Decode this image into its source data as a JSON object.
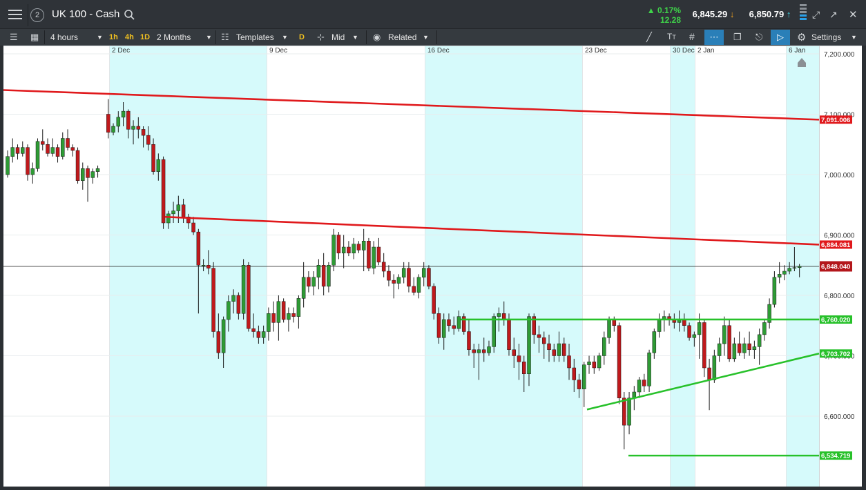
{
  "app": {
    "menu_icon": "hamburger-menu-icon",
    "layout_number": "2",
    "title": "UK 100 - Cash",
    "search_icon": "search-icon"
  },
  "quote": {
    "change_pct": "0.17%",
    "change_pts": "12.28",
    "sell": "6,845.29",
    "buy": "6,850.79",
    "up_color": "#3fd44a",
    "sell_bg": "#6b5530",
    "buy_bg": "#1f5e73"
  },
  "toolbar": {
    "interval": "4 hours",
    "quick_1h": "1h",
    "quick_4h": "4h",
    "quick_1d": "1D",
    "range": "2 Months",
    "templates": "Templates",
    "daily": "D",
    "price_type": "Mid",
    "related": "Related",
    "settings": "Settings"
  },
  "chart_data": {
    "type": "candlestick",
    "instrument": "UK 100 - Cash",
    "interval": "4 hours",
    "x_tick_labels": [
      "2 Dec",
      "9 Dec",
      "16 Dec",
      "23 Dec",
      "30 Dec",
      "2 Jan",
      "6 Jan"
    ],
    "y_tick_labels": [
      "7,200.000",
      "7,100.000",
      "7,000.000",
      "6,900.000",
      "6,800.000",
      "6,700.000",
      "6,600.000"
    ],
    "ylim": [
      6510,
      7215
    ],
    "grid": true,
    "current_price": "6,848.040",
    "candles_ohlc": [
      [
        7000,
        7040,
        6995,
        7030
      ],
      [
        7030,
        7060,
        7020,
        7045
      ],
      [
        7045,
        7050,
        7025,
        7035
      ],
      [
        7035,
        7055,
        7030,
        7045
      ],
      [
        7045,
        7050,
        6990,
        7000
      ],
      [
        7000,
        7020,
        6985,
        7010
      ],
      [
        7010,
        7060,
        7005,
        7055
      ],
      [
        7055,
        7075,
        7040,
        7050
      ],
      [
        7050,
        7060,
        7030,
        7035
      ],
      [
        7035,
        7060,
        7030,
        7045
      ],
      [
        7045,
        7050,
        7020,
        7030
      ],
      [
        7030,
        7070,
        7025,
        7060
      ],
      [
        7060,
        7075,
        7040,
        7045
      ],
      [
        7045,
        7050,
        7030,
        7040
      ],
      [
        7040,
        7045,
        6985,
        6990
      ],
      [
        6990,
        7020,
        6975,
        7010
      ],
      [
        7010,
        7015,
        6955,
        6995
      ],
      [
        6995,
        7010,
        6985,
        7005
      ],
      [
        7005,
        7015,
        6995,
        7010
      ],
      [
        7100,
        7125,
        7060,
        7070
      ],
      [
        7070,
        7085,
        7065,
        7080
      ],
      [
        7080,
        7105,
        7070,
        7095
      ],
      [
        7095,
        7120,
        7080,
        7105
      ],
      [
        7105,
        7108,
        7060,
        7075
      ],
      [
        7075,
        7090,
        7050,
        7080
      ],
      [
        7080,
        7095,
        7060,
        7075
      ],
      [
        7075,
        7080,
        7045,
        7065
      ],
      [
        7065,
        7080,
        7040,
        7050
      ],
      [
        7050,
        7060,
        7000,
        7005
      ],
      [
        7005,
        7035,
        6990,
        7025
      ],
      [
        7025,
        7030,
        6910,
        6920
      ],
      [
        6920,
        6940,
        6910,
        6935
      ],
      [
        6935,
        6955,
        6920,
        6940
      ],
      [
        6940,
        6965,
        6920,
        6950
      ],
      [
        6950,
        6960,
        6920,
        6930
      ],
      [
        6930,
        6935,
        6910,
        6920
      ],
      [
        6920,
        6930,
        6900,
        6905
      ],
      [
        6905,
        6910,
        6770,
        6850
      ],
      [
        6850,
        6860,
        6840,
        6850
      ],
      [
        6850,
        6875,
        6835,
        6845
      ],
      [
        6845,
        6855,
        6730,
        6740
      ],
      [
        6740,
        6770,
        6695,
        6705
      ],
      [
        6705,
        6765,
        6680,
        6760
      ],
      [
        6760,
        6800,
        6740,
        6790
      ],
      [
        6790,
        6810,
        6770,
        6800
      ],
      [
        6800,
        6805,
        6760,
        6770
      ],
      [
        6770,
        6860,
        6760,
        6850
      ],
      [
        6850,
        6855,
        6740,
        6745
      ],
      [
        6745,
        6770,
        6730,
        6740
      ],
      [
        6740,
        6750,
        6720,
        6730
      ],
      [
        6730,
        6750,
        6720,
        6740
      ],
      [
        6740,
        6780,
        6725,
        6770
      ],
      [
        6770,
        6790,
        6740,
        6755
      ],
      [
        6755,
        6800,
        6725,
        6790
      ],
      [
        6790,
        6795,
        6755,
        6760
      ],
      [
        6760,
        6780,
        6740,
        6770
      ],
      [
        6770,
        6780,
        6755,
        6765
      ],
      [
        6765,
        6800,
        6745,
        6795
      ],
      [
        6795,
        6855,
        6780,
        6830
      ],
      [
        6830,
        6840,
        6805,
        6815
      ],
      [
        6815,
        6840,
        6800,
        6830
      ],
      [
        6830,
        6860,
        6810,
        6850
      ],
      [
        6850,
        6870,
        6800,
        6815
      ],
      [
        6815,
        6855,
        6805,
        6850
      ],
      [
        6850,
        6910,
        6840,
        6900
      ],
      [
        6900,
        6905,
        6860,
        6870
      ],
      [
        6870,
        6900,
        6845,
        6880
      ],
      [
        6880,
        6890,
        6865,
        6870
      ],
      [
        6870,
        6895,
        6860,
        6885
      ],
      [
        6885,
        6890,
        6870,
        6875
      ],
      [
        6875,
        6910,
        6840,
        6890
      ],
      [
        6890,
        6895,
        6840,
        6845
      ],
      [
        6845,
        6890,
        6835,
        6880
      ],
      [
        6880,
        6895,
        6850,
        6855
      ],
      [
        6855,
        6870,
        6830,
        6840
      ],
      [
        6840,
        6850,
        6815,
        6825
      ],
      [
        6825,
        6835,
        6795,
        6820
      ],
      [
        6820,
        6835,
        6810,
        6830
      ],
      [
        6830,
        6855,
        6820,
        6845
      ],
      [
        6845,
        6855,
        6805,
        6815
      ],
      [
        6815,
        6830,
        6800,
        6805
      ],
      [
        6805,
        6835,
        6795,
        6830
      ],
      [
        6830,
        6855,
        6815,
        6845
      ],
      [
        6845,
        6850,
        6810,
        6815
      ],
      [
        6815,
        6820,
        6760,
        6770
      ],
      [
        6770,
        6780,
        6720,
        6730
      ],
      [
        6730,
        6770,
        6710,
        6760
      ],
      [
        6760,
        6770,
        6740,
        6750
      ],
      [
        6750,
        6765,
        6735,
        6745
      ],
      [
        6745,
        6775,
        6740,
        6765
      ],
      [
        6765,
        6770,
        6735,
        6740
      ],
      [
        6740,
        6760,
        6700,
        6710
      ],
      [
        6710,
        6720,
        6680,
        6705
      ],
      [
        6705,
        6720,
        6660,
        6710
      ],
      [
        6710,
        6730,
        6690,
        6705
      ],
      [
        6705,
        6725,
        6700,
        6715
      ],
      [
        6715,
        6770,
        6705,
        6765
      ],
      [
        6765,
        6780,
        6740,
        6770
      ],
      [
        6770,
        6790,
        6750,
        6760
      ],
      [
        6760,
        6770,
        6700,
        6710
      ],
      [
        6710,
        6730,
        6680,
        6700
      ],
      [
        6700,
        6720,
        6660,
        6690
      ],
      [
        6690,
        6700,
        6640,
        6670
      ],
      [
        6670,
        6770,
        6650,
        6765
      ],
      [
        6765,
        6770,
        6720,
        6735
      ],
      [
        6735,
        6750,
        6705,
        6730
      ],
      [
        6730,
        6740,
        6695,
        6720
      ],
      [
        6720,
        6735,
        6690,
        6710
      ],
      [
        6710,
        6720,
        6690,
        6700
      ],
      [
        6700,
        6740,
        6690,
        6720
      ],
      [
        6720,
        6730,
        6690,
        6700
      ],
      [
        6700,
        6720,
        6660,
        6680
      ],
      [
        6680,
        6695,
        6640,
        6660
      ],
      [
        6660,
        6670,
        6630,
        6645
      ],
      [
        6645,
        6690,
        6615,
        6685
      ],
      [
        6685,
        6700,
        6670,
        6690
      ],
      [
        6690,
        6700,
        6670,
        6680
      ],
      [
        6680,
        6705,
        6675,
        6700
      ],
      [
        6700,
        6740,
        6685,
        6730
      ],
      [
        6730,
        6765,
        6720,
        6760
      ],
      [
        6760,
        6765,
        6740,
        6750
      ],
      [
        6750,
        6755,
        6620,
        6630
      ],
      [
        6630,
        6640,
        6545,
        6585
      ],
      [
        6585,
        6640,
        6570,
        6630
      ],
      [
        6630,
        6650,
        6610,
        6640
      ],
      [
        6640,
        6665,
        6630,
        6660
      ],
      [
        6660,
        6670,
        6640,
        6650
      ],
      [
        6650,
        6710,
        6640,
        6705
      ],
      [
        6705,
        6745,
        6695,
        6740
      ],
      [
        6740,
        6770,
        6730,
        6760
      ],
      [
        6760,
        6775,
        6740,
        6765
      ],
      [
        6765,
        6770,
        6750,
        6760
      ],
      [
        6760,
        6770,
        6745,
        6755
      ],
      [
        6755,
        6775,
        6740,
        6760
      ],
      [
        6760,
        6770,
        6740,
        6750
      ],
      [
        6750,
        6755,
        6725,
        6730
      ],
      [
        6730,
        6740,
        6715,
        6735
      ],
      [
        6735,
        6770,
        6695,
        6755
      ],
      [
        6755,
        6760,
        6665,
        6680
      ],
      [
        6680,
        6695,
        6610,
        6660
      ],
      [
        6660,
        6710,
        6655,
        6700
      ],
      [
        6700,
        6730,
        6690,
        6720
      ],
      [
        6720,
        6765,
        6700,
        6750
      ],
      [
        6750,
        6760,
        6690,
        6695
      ],
      [
        6695,
        6730,
        6690,
        6720
      ],
      [
        6720,
        6740,
        6700,
        6705
      ],
      [
        6705,
        6730,
        6695,
        6720
      ],
      [
        6720,
        6740,
        6700,
        6710
      ],
      [
        6710,
        6725,
        6695,
        6715
      ],
      [
        6715,
        6745,
        6685,
        6735
      ],
      [
        6735,
        6760,
        6725,
        6755
      ],
      [
        6755,
        6795,
        6745,
        6785
      ],
      [
        6785,
        6840,
        6780,
        6830
      ],
      [
        6830,
        6855,
        6820,
        6835
      ],
      [
        6835,
        6850,
        6825,
        6840
      ],
      [
        6840,
        6855,
        6835,
        6845
      ],
      [
        6845,
        6880,
        6840,
        6846
      ],
      [
        6846,
        6852,
        6830,
        6848
      ]
    ],
    "series_colors": {
      "up": "#2e9b35",
      "down": "#c0191c"
    },
    "annotations": [
      {
        "kind": "trendline",
        "color": "#e0191c",
        "label": "7,091.006"
      },
      {
        "kind": "trendline",
        "color": "#e0191c",
        "label": "6,884.081"
      },
      {
        "kind": "horizontal",
        "color": "#27c12a",
        "label": "6,760.020"
      },
      {
        "kind": "trendline",
        "color": "#27c12a",
        "label": "6,703.702"
      },
      {
        "kind": "horizontal",
        "color": "#27c12a",
        "label": "6,534.719"
      }
    ],
    "current_price_color": "#b3171b",
    "weekend_shade_color": "#d6fafb"
  }
}
